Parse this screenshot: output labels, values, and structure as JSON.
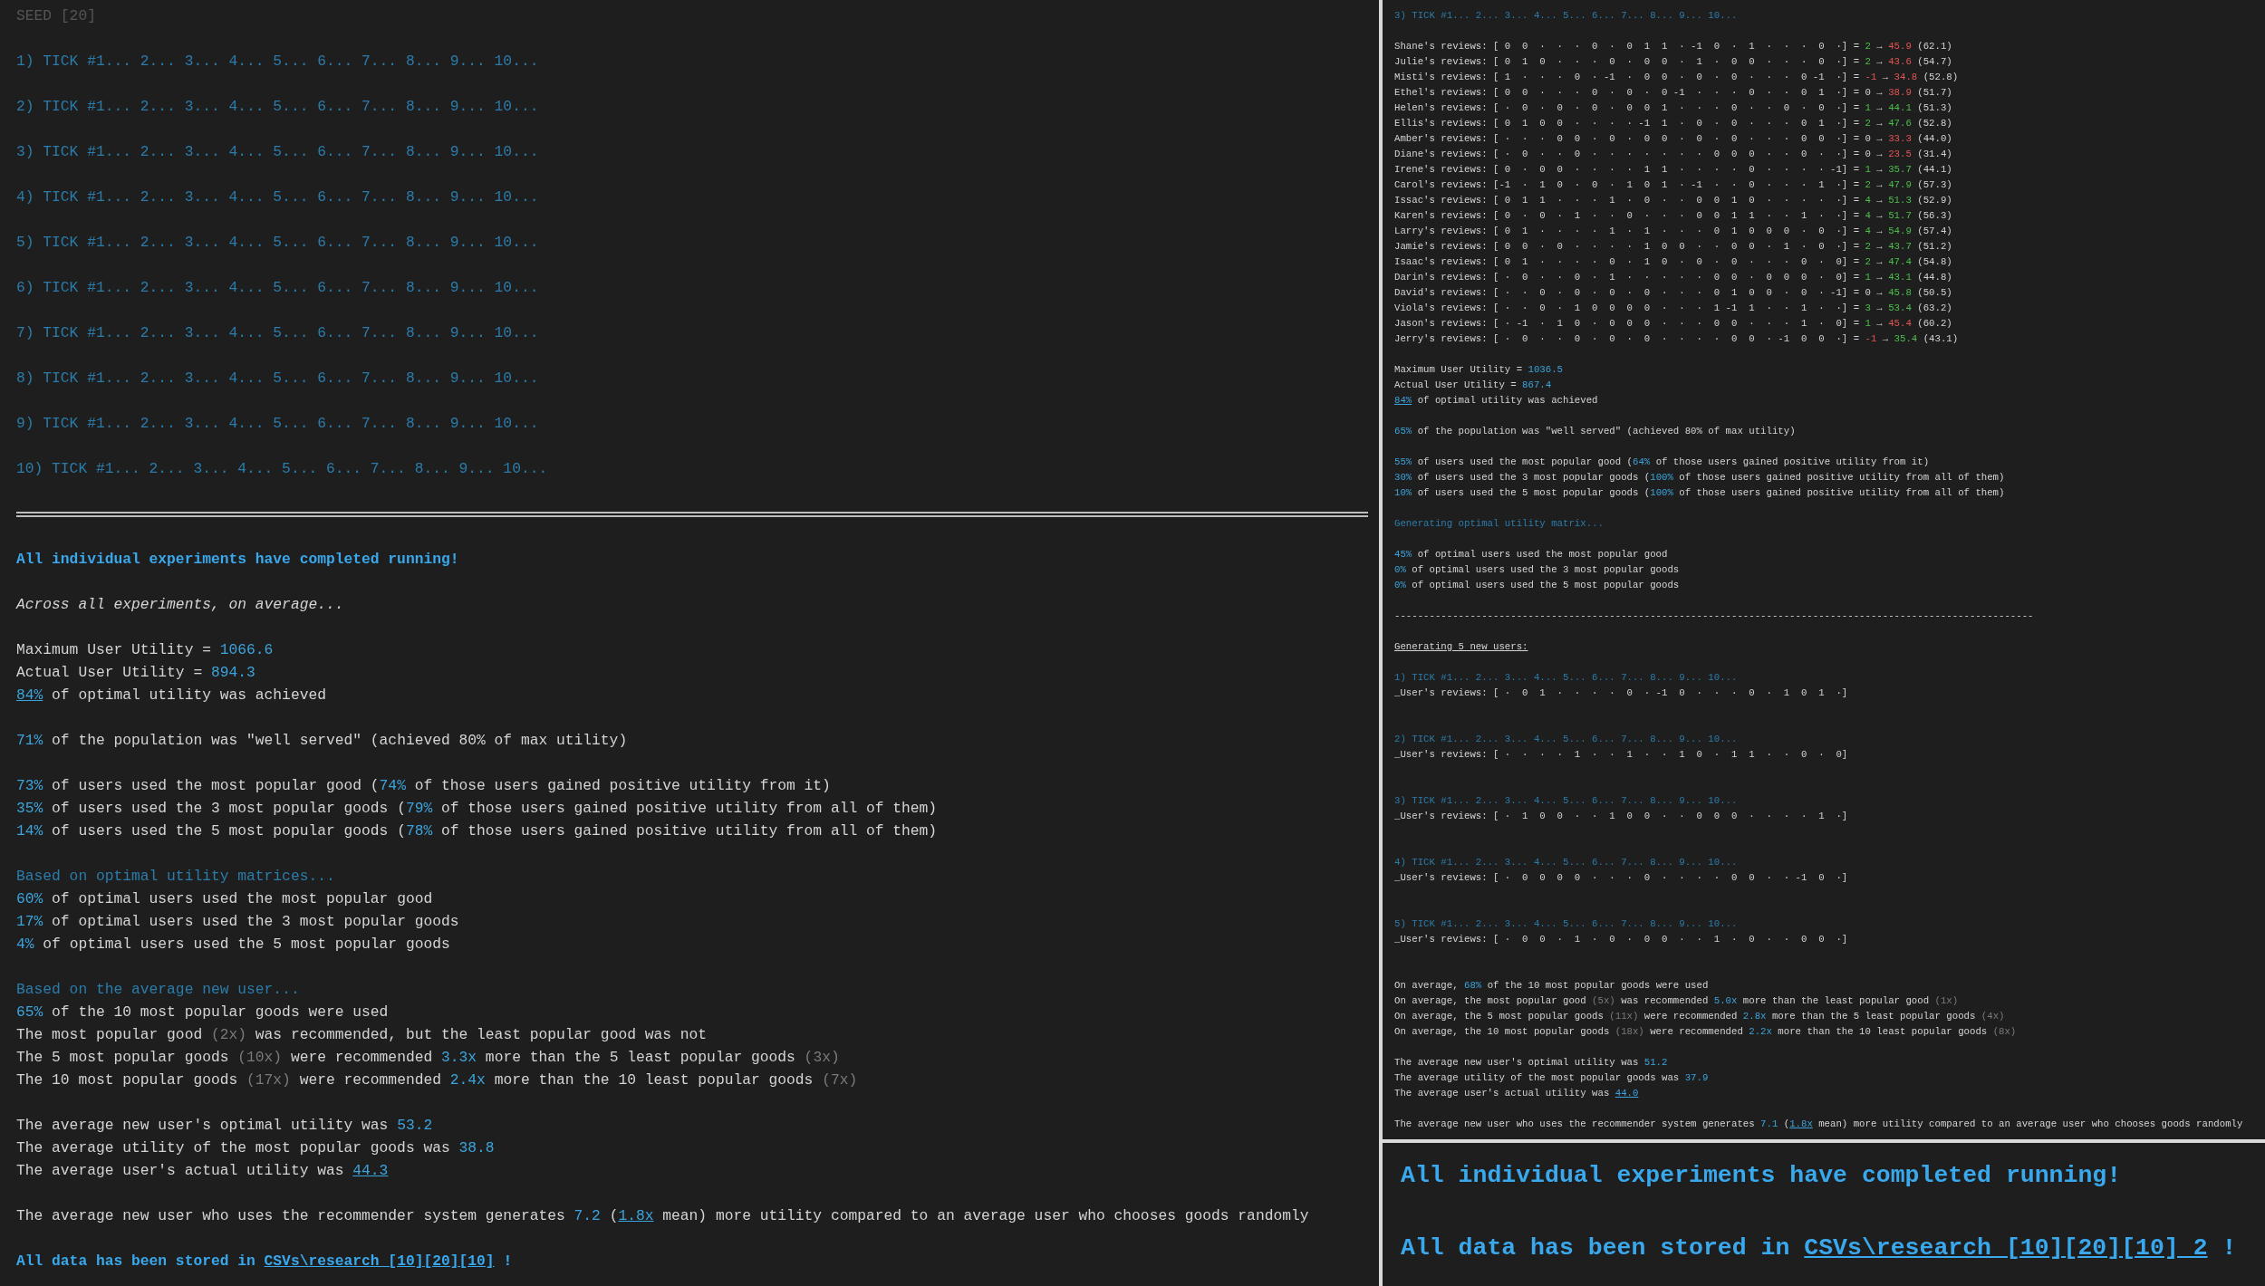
{
  "left_panel": {
    "lines": [
      {
        "kind": "text",
        "segments": [
          {
            "text": "SEED [20]",
            "kind": "seed"
          }
        ]
      },
      {
        "kind": "blank"
      },
      {
        "kind": "text",
        "segments": [
          {
            "text": "1) TICK #1... 2... 3... 4... 5... 6... 7... 8... 9... 10...",
            "kind": "dim"
          }
        ]
      },
      {
        "kind": "blank"
      },
      {
        "kind": "text",
        "segments": [
          {
            "text": "2) TICK #1... 2... 3... 4... 5... 6... 7... 8... 9... 10...",
            "kind": "dim"
          }
        ]
      },
      {
        "kind": "blank"
      },
      {
        "kind": "text",
        "segments": [
          {
            "text": "3) TICK #1... 2... 3... 4... 5... 6... 7... 8... 9... 10...",
            "kind": "dim"
          }
        ]
      },
      {
        "kind": "blank"
      },
      {
        "kind": "text",
        "segments": [
          {
            "text": "4) TICK #1... 2... 3... 4... 5... 6... 7... 8... 9... 10...",
            "kind": "dim"
          }
        ]
      },
      {
        "kind": "blank"
      },
      {
        "kind": "text",
        "segments": [
          {
            "text": "5) TICK #1... 2... 3... 4... 5... 6... 7... 8... 9... 10...",
            "kind": "dim"
          }
        ]
      },
      {
        "kind": "blank"
      },
      {
        "kind": "text",
        "segments": [
          {
            "text": "6) TICK #1... 2... 3... 4... 5... 6... 7... 8... 9... 10...",
            "kind": "dim"
          }
        ]
      },
      {
        "kind": "blank"
      },
      {
        "kind": "text",
        "segments": [
          {
            "text": "7) TICK #1... 2... 3... 4... 5... 6... 7... 8... 9... 10...",
            "kind": "dim"
          }
        ]
      },
      {
        "kind": "blank"
      },
      {
        "kind": "text",
        "segments": [
          {
            "text": "8) TICK #1... 2... 3... 4... 5... 6... 7... 8... 9... 10...",
            "kind": "dim"
          }
        ]
      },
      {
        "kind": "blank"
      },
      {
        "kind": "text",
        "segments": [
          {
            "text": "9) TICK #1... 2... 3... 4... 5... 6... 7... 8... 9... 10...",
            "kind": "dim"
          }
        ]
      },
      {
        "kind": "blank"
      },
      {
        "kind": "text",
        "segments": [
          {
            "text": "10) TICK #1... 2... 3... 4... 5... 6... 7... 8... 9... 10...",
            "kind": "dim"
          }
        ]
      },
      {
        "kind": "blank"
      },
      {
        "kind": "double_rule"
      },
      {
        "kind": "blank"
      },
      {
        "kind": "text",
        "segments": [
          {
            "text": "All individual experiments have completed running!",
            "kind": "title"
          }
        ]
      },
      {
        "kind": "blank"
      },
      {
        "kind": "text",
        "segments": [
          {
            "text": "Across all experiments, on average...",
            "kind": "italic"
          }
        ]
      },
      {
        "kind": "blank"
      },
      {
        "kind": "text",
        "segments": [
          {
            "text": "Maximum User Utility = ",
            "kind": "plain"
          },
          {
            "text": "1066.6",
            "kind": "value"
          }
        ]
      },
      {
        "kind": "text",
        "segments": [
          {
            "text": "Actual User Utility = ",
            "kind": "plain"
          },
          {
            "text": "894.3",
            "kind": "value"
          }
        ]
      },
      {
        "kind": "text",
        "segments": [
          {
            "text": "84%",
            "kind": "link"
          },
          {
            "text": " of optimal utility was achieved",
            "kind": "plain"
          }
        ]
      },
      {
        "kind": "blank"
      },
      {
        "kind": "text",
        "segments": [
          {
            "text": "71%",
            "kind": "value"
          },
          {
            "text": " of the population was \"well served\" (achieved 80% of max utility)",
            "kind": "plain"
          }
        ]
      },
      {
        "kind": "blank"
      },
      {
        "kind": "text",
        "segments": [
          {
            "text": "73%",
            "kind": "value"
          },
          {
            "text": " of users used the most popular good (",
            "kind": "plain"
          },
          {
            "text": "74%",
            "kind": "value"
          },
          {
            "text": " of those users gained positive utility from it)",
            "kind": "plain"
          }
        ]
      },
      {
        "kind": "text",
        "segments": [
          {
            "text": "35%",
            "kind": "value"
          },
          {
            "text": " of users used the 3 most popular goods (",
            "kind": "plain"
          },
          {
            "text": "79%",
            "kind": "value"
          },
          {
            "text": " of those users gained positive utility from all of them)",
            "kind": "plain"
          }
        ]
      },
      {
        "kind": "text",
        "segments": [
          {
            "text": "14%",
            "kind": "value"
          },
          {
            "text": " of users used the 5 most popular goods (",
            "kind": "plain"
          },
          {
            "text": "78%",
            "kind": "value"
          },
          {
            "text": " of those users gained positive utility from all of them)",
            "kind": "plain"
          }
        ]
      },
      {
        "kind": "blank"
      },
      {
        "kind": "text",
        "segments": [
          {
            "text": "Based on optimal utility matrices...",
            "kind": "dim"
          }
        ]
      },
      {
        "kind": "text",
        "segments": [
          {
            "text": "60%",
            "kind": "value"
          },
          {
            "text": " of optimal users used the most popular good",
            "kind": "plain"
          }
        ]
      },
      {
        "kind": "text",
        "segments": [
          {
            "text": "17%",
            "kind": "value"
          },
          {
            "text": " of optimal users used the 3 most popular goods",
            "kind": "plain"
          }
        ]
      },
      {
        "kind": "text",
        "segments": [
          {
            "text": "4%",
            "kind": "value"
          },
          {
            "text": " of optimal users used the 5 most popular goods",
            "kind": "plain"
          }
        ]
      },
      {
        "kind": "blank"
      },
      {
        "kind": "text",
        "segments": [
          {
            "text": "Based on the average new user...",
            "kind": "dim"
          }
        ]
      },
      {
        "kind": "text",
        "segments": [
          {
            "text": "65%",
            "kind": "value"
          },
          {
            "text": " of the 10 most popular goods were used",
            "kind": "plain"
          }
        ]
      },
      {
        "kind": "text",
        "segments": [
          {
            "text": "The most popular good ",
            "kind": "plain"
          },
          {
            "text": "(2x)",
            "kind": "muted"
          },
          {
            "text": " was recommended, but the least popular good was not",
            "kind": "plain"
          }
        ]
      },
      {
        "kind": "text",
        "segments": [
          {
            "text": "The 5 most popular goods ",
            "kind": "plain"
          },
          {
            "text": "(10x)",
            "kind": "muted"
          },
          {
            "text": " were recommended ",
            "kind": "plain"
          },
          {
            "text": "3.3x",
            "kind": "value"
          },
          {
            "text": " more than the 5 least popular goods ",
            "kind": "plain"
          },
          {
            "text": "(3x)",
            "kind": "muted"
          }
        ]
      },
      {
        "kind": "text",
        "segments": [
          {
            "text": "The 10 most popular goods ",
            "kind": "plain"
          },
          {
            "text": "(17x)",
            "kind": "muted"
          },
          {
            "text": " were recommended ",
            "kind": "plain"
          },
          {
            "text": "2.4x",
            "kind": "value"
          },
          {
            "text": " more than the 10 least popular goods ",
            "kind": "plain"
          },
          {
            "text": "(7x)",
            "kind": "muted"
          }
        ]
      },
      {
        "kind": "blank"
      },
      {
        "kind": "text",
        "segments": [
          {
            "text": "The average new user's optimal utility was ",
            "kind": "plain"
          },
          {
            "text": "53.2",
            "kind": "value"
          }
        ]
      },
      {
        "kind": "text",
        "segments": [
          {
            "text": "The average utility of the most popular goods was ",
            "kind": "plain"
          },
          {
            "text": "38.8",
            "kind": "value"
          }
        ]
      },
      {
        "kind": "text",
        "segments": [
          {
            "text": "The average user's actual utility was ",
            "kind": "plain"
          },
          {
            "text": "44.3",
            "kind": "link"
          }
        ]
      },
      {
        "kind": "blank"
      },
      {
        "kind": "text",
        "segments": [
          {
            "text": "The average new user who uses the recommender system generates ",
            "kind": "plain"
          },
          {
            "text": "7.2",
            "kind": "value"
          },
          {
            "text": " (",
            "kind": "plain"
          },
          {
            "text": "1.8x",
            "kind": "link"
          },
          {
            "text": " mean) more utility compared to an average user who chooses goods randomly",
            "kind": "plain"
          }
        ]
      },
      {
        "kind": "blank"
      },
      {
        "kind": "text",
        "segments": [
          {
            "text": "All data has been stored in ",
            "kind": "title"
          },
          {
            "text": "CSVs\\research_[10][20][10]",
            "kind": "title_link"
          },
          {
            "text": " !",
            "kind": "title"
          }
        ]
      }
    ]
  },
  "right_panel": {
    "lines": [
      {
        "kind": "text",
        "segments": [
          {
            "text": "3) TICK #1... 2... 3... 4... 5... 6... 7... 8... 9... 10...",
            "kind": "dim"
          }
        ]
      },
      {
        "kind": "blank"
      },
      {
        "kind": "text",
        "segments": [
          {
            "text": "Shane's reviews: [ 0  0  ·  ·  ·  0  ·  0  1  1  · -1  0  ·  1  ·  ·  ·  0  ·] = ",
            "kind": "plain"
          },
          {
            "text": "2",
            "kind": "green"
          },
          {
            "text": " → ",
            "kind": "plain"
          },
          {
            "text": "45.9",
            "kind": "red"
          },
          {
            "text": " (62.1)",
            "kind": "plain"
          }
        ]
      },
      {
        "kind": "text",
        "segments": [
          {
            "text": "Julie's reviews: [ 0  1  0  ·  ·  ·  0  ·  0  0  ·  1  ·  0  0  ·  ·  ·  0  ·] = ",
            "kind": "plain"
          },
          {
            "text": "2",
            "kind": "green"
          },
          {
            "text": " → ",
            "kind": "plain"
          },
          {
            "text": "43.6",
            "kind": "red"
          },
          {
            "text": " (54.7)",
            "kind": "plain"
          }
        ]
      },
      {
        "kind": "text",
        "segments": [
          {
            "text": "Misti's reviews: [ 1  ·  ·  ·  0  · -1  ·  0  0  ·  0  ·  0  ·  ·  ·  0 -1  ·] = ",
            "kind": "plain"
          },
          {
            "text": "-1",
            "kind": "red"
          },
          {
            "text": " → ",
            "kind": "plain"
          },
          {
            "text": "34.8",
            "kind": "red"
          },
          {
            "text": " (52.8)",
            "kind": "plain"
          }
        ]
      },
      {
        "kind": "text",
        "segments": [
          {
            "text": "Ethel's reviews: [ 0  0  ·  ·  ·  0  ·  0  ·  0 -1  ·  ·  ·  0  ·  ·  0  1  ·] = ",
            "kind": "plain"
          },
          {
            "text": "0",
            "kind": "plain"
          },
          {
            "text": " → ",
            "kind": "plain"
          },
          {
            "text": "38.9",
            "kind": "red"
          },
          {
            "text": " (51.7)",
            "kind": "plain"
          }
        ]
      },
      {
        "kind": "text",
        "segments": [
          {
            "text": "Helen's reviews: [ ·  0  ·  0  ·  0  ·  0  0  1  ·  ·  ·  0  ·  ·  0  ·  0  ·] = ",
            "kind": "plain"
          },
          {
            "text": "1",
            "kind": "green"
          },
          {
            "text": " → ",
            "kind": "plain"
          },
          {
            "text": "44.1",
            "kind": "green"
          },
          {
            "text": " (51.3)",
            "kind": "plain"
          }
        ]
      },
      {
        "kind": "text",
        "segments": [
          {
            "text": "Ellis's reviews: [ 0  1  0  0  ·  ·  ·  · -1  1  ·  0  ·  0  ·  ·  ·  0  1  ·] = ",
            "kind": "plain"
          },
          {
            "text": "2",
            "kind": "green"
          },
          {
            "text": " → ",
            "kind": "plain"
          },
          {
            "text": "47.6",
            "kind": "green"
          },
          {
            "text": " (52.8)",
            "kind": "plain"
          }
        ]
      },
      {
        "kind": "text",
        "segments": [
          {
            "text": "Amber's reviews: [ ·  ·  ·  0  0  ·  0  ·  0  0  ·  0  ·  0  ·  ·  ·  0  0  ·] = ",
            "kind": "plain"
          },
          {
            "text": "0",
            "kind": "plain"
          },
          {
            "text": " → ",
            "kind": "plain"
          },
          {
            "text": "33.3",
            "kind": "red"
          },
          {
            "text": " (44.0)",
            "kind": "plain"
          }
        ]
      },
      {
        "kind": "text",
        "segments": [
          {
            "text": "Diane's reviews: [ ·  0  ·  ·  0  ·  ·  ·  ·  ·  ·  ·  0  0  0  ·  ·  0  ·  ·] = ",
            "kind": "plain"
          },
          {
            "text": "0",
            "kind": "plain"
          },
          {
            "text": " → ",
            "kind": "plain"
          },
          {
            "text": "23.5",
            "kind": "red"
          },
          {
            "text": " (31.4)",
            "kind": "plain"
          }
        ]
      },
      {
        "kind": "text",
        "segments": [
          {
            "text": "Irene's reviews: [ 0  ·  0  0  ·  ·  ·  ·  1  1  ·  ·  ·  ·  0  ·  ·  ·  · -1] = ",
            "kind": "plain"
          },
          {
            "text": "1",
            "kind": "green"
          },
          {
            "text": " → ",
            "kind": "plain"
          },
          {
            "text": "35.7",
            "kind": "green"
          },
          {
            "text": " (44.1)",
            "kind": "plain"
          }
        ]
      },
      {
        "kind": "text",
        "segments": [
          {
            "text": "Carol's reviews: [-1  ·  1  0  ·  0  ·  1  0  1  · -1  ·  ·  0  ·  ·  ·  1  ·] = ",
            "kind": "plain"
          },
          {
            "text": "2",
            "kind": "green"
          },
          {
            "text": " → ",
            "kind": "plain"
          },
          {
            "text": "47.9",
            "kind": "green"
          },
          {
            "text": " (57.3)",
            "kind": "plain"
          }
        ]
      },
      {
        "kind": "text",
        "segments": [
          {
            "text": "Issac's reviews: [ 0  1  1  ·  ·  ·  1  ·  0  ·  ·  0  0  1  0  ·  ·  ·  ·  ·] = ",
            "kind": "plain"
          },
          {
            "text": "4",
            "kind": "green"
          },
          {
            "text": " → ",
            "kind": "plain"
          },
          {
            "text": "51.3",
            "kind": "green"
          },
          {
            "text": " (52.9)",
            "kind": "plain"
          }
        ]
      },
      {
        "kind": "text",
        "segments": [
          {
            "text": "Karen's reviews: [ 0  ·  0  ·  1  ·  ·  0  ·  ·  ·  0  0  1  1  ·  ·  1  ·  ·] = ",
            "kind": "plain"
          },
          {
            "text": "4",
            "kind": "green"
          },
          {
            "text": " → ",
            "kind": "plain"
          },
          {
            "text": "51.7",
            "kind": "green"
          },
          {
            "text": " (56.3)",
            "kind": "plain"
          }
        ]
      },
      {
        "kind": "text",
        "segments": [
          {
            "text": "Larry's reviews: [ 0  1  ·  ·  ·  ·  1  ·  1  ·  ·  ·  0  1  0  0  0  ·  0  ·] = ",
            "kind": "plain"
          },
          {
            "text": "4",
            "kind": "green"
          },
          {
            "text": " → ",
            "kind": "plain"
          },
          {
            "text": "54.9",
            "kind": "green"
          },
          {
            "text": " (57.4)",
            "kind": "plain"
          }
        ]
      },
      {
        "kind": "text",
        "segments": [
          {
            "text": "Jamie's reviews: [ 0  0  ·  0  ·  ·  ·  ·  1  0  0  ·  ·  0  0  ·  1  ·  0  ·] = ",
            "kind": "plain"
          },
          {
            "text": "2",
            "kind": "green"
          },
          {
            "text": " → ",
            "kind": "plain"
          },
          {
            "text": "43.7",
            "kind": "green"
          },
          {
            "text": " (51.2)",
            "kind": "plain"
          }
        ]
      },
      {
        "kind": "text",
        "segments": [
          {
            "text": "Isaac's reviews: [ 0  1  ·  ·  ·  ·  0  ·  1  0  ·  0  ·  0  ·  ·  ·  0  ·  0] = ",
            "kind": "plain"
          },
          {
            "text": "2",
            "kind": "green"
          },
          {
            "text": " → ",
            "kind": "plain"
          },
          {
            "text": "47.4",
            "kind": "green"
          },
          {
            "text": " (54.8)",
            "kind": "plain"
          }
        ]
      },
      {
        "kind": "text",
        "segments": [
          {
            "text": "Darin's reviews: [ ·  0  ·  ·  0  ·  1  ·  ·  ·  ·  ·  0  0  ·  0  0  0  ·  0] = ",
            "kind": "plain"
          },
          {
            "text": "1",
            "kind": "green"
          },
          {
            "text": " → ",
            "kind": "plain"
          },
          {
            "text": "43.1",
            "kind": "green"
          },
          {
            "text": " (44.8)",
            "kind": "plain"
          }
        ]
      },
      {
        "kind": "text",
        "segments": [
          {
            "text": "David's reviews: [ ·  ·  0  ·  0  ·  0  ·  0  ·  ·  ·  0  1  0  0  ·  0  · -1] = ",
            "kind": "plain"
          },
          {
            "text": "0",
            "kind": "plain"
          },
          {
            "text": " → ",
            "kind": "plain"
          },
          {
            "text": "45.8",
            "kind": "green"
          },
          {
            "text": " (50.5)",
            "kind": "plain"
          }
        ]
      },
      {
        "kind": "text",
        "segments": [
          {
            "text": "Viola's reviews: [ ·  ·  0  ·  1  0  0  0  0  ·  ·  ·  1 -1  1  ·  ·  1  ·  ·] = ",
            "kind": "plain"
          },
          {
            "text": "3",
            "kind": "green"
          },
          {
            "text": " → ",
            "kind": "plain"
          },
          {
            "text": "53.4",
            "kind": "green"
          },
          {
            "text": " (63.2)",
            "kind": "plain"
          }
        ]
      },
      {
        "kind": "text",
        "segments": [
          {
            "text": "Jason's reviews: [ · -1  ·  1  0  ·  0  0  0  ·  ·  ·  0  0  ·  ·  ·  1  ·  0] = ",
            "kind": "plain"
          },
          {
            "text": "1",
            "kind": "green"
          },
          {
            "text": " → ",
            "kind": "plain"
          },
          {
            "text": "45.4",
            "kind": "red"
          },
          {
            "text": " (60.2)",
            "kind": "plain"
          }
        ]
      },
      {
        "kind": "text",
        "segments": [
          {
            "text": "Jerry's reviews: [ ·  0  ·  ·  0  ·  0  ·  0  ·  ·  ·  ·  0  0  · -1  0  0  ·] = ",
            "kind": "plain"
          },
          {
            "text": "-1",
            "kind": "red"
          },
          {
            "text": " → ",
            "kind": "plain"
          },
          {
            "text": "35.4",
            "kind": "green"
          },
          {
            "text": " (43.1)",
            "kind": "plain"
          }
        ]
      },
      {
        "kind": "blank"
      },
      {
        "kind": "text",
        "segments": [
          {
            "text": "Maximum User Utility = ",
            "kind": "plain"
          },
          {
            "text": "1036.5",
            "kind": "value"
          }
        ]
      },
      {
        "kind": "text",
        "segments": [
          {
            "text": "Actual User Utility = ",
            "kind": "plain"
          },
          {
            "text": "867.4",
            "kind": "value"
          }
        ]
      },
      {
        "kind": "text",
        "segments": [
          {
            "text": "84%",
            "kind": "link"
          },
          {
            "text": " of optimal utility was achieved",
            "kind": "plain"
          }
        ]
      },
      {
        "kind": "blank"
      },
      {
        "kind": "text",
        "segments": [
          {
            "text": "65%",
            "kind": "value"
          },
          {
            "text": " of the population was \"well served\" (achieved 80% of max utility)",
            "kind": "plain"
          }
        ]
      },
      {
        "kind": "blank"
      },
      {
        "kind": "text",
        "segments": [
          {
            "text": "55%",
            "kind": "value"
          },
          {
            "text": " of users used the most popular good (",
            "kind": "plain"
          },
          {
            "text": "64%",
            "kind": "value"
          },
          {
            "text": " of those users gained positive utility from it)",
            "kind": "plain"
          }
        ]
      },
      {
        "kind": "text",
        "segments": [
          {
            "text": "30%",
            "kind": "value"
          },
          {
            "text": " of users used the 3 most popular goods (",
            "kind": "plain"
          },
          {
            "text": "100%",
            "kind": "value"
          },
          {
            "text": " of those users gained positive utility from all of them)",
            "kind": "plain"
          }
        ]
      },
      {
        "kind": "text",
        "segments": [
          {
            "text": "10%",
            "kind": "value"
          },
          {
            "text": " of users used the 5 most popular goods (",
            "kind": "plain"
          },
          {
            "text": "100%",
            "kind": "value"
          },
          {
            "text": " of those users gained positive utility from all of them)",
            "kind": "plain"
          }
        ]
      },
      {
        "kind": "blank"
      },
      {
        "kind": "text",
        "segments": [
          {
            "text": "Generating optimal utility matrix...",
            "kind": "dim"
          }
        ]
      },
      {
        "kind": "blank"
      },
      {
        "kind": "text",
        "segments": [
          {
            "text": "45%",
            "kind": "value"
          },
          {
            "text": " of optimal users used the most popular good",
            "kind": "plain"
          }
        ]
      },
      {
        "kind": "text",
        "segments": [
          {
            "text": "0%",
            "kind": "value"
          },
          {
            "text": " of optimal users used the 3 most popular goods",
            "kind": "plain"
          }
        ]
      },
      {
        "kind": "text",
        "segments": [
          {
            "text": "0%",
            "kind": "value"
          },
          {
            "text": " of optimal users used the 5 most popular goods",
            "kind": "plain"
          }
        ]
      },
      {
        "kind": "blank"
      },
      {
        "kind": "text",
        "segments": [
          {
            "text": "--------------------------------------------------------------------------------------------------------------",
            "kind": "plain"
          }
        ]
      },
      {
        "kind": "blank"
      },
      {
        "kind": "text",
        "segments": [
          {
            "text": "Generating 5 new users:",
            "kind": "underline"
          }
        ]
      },
      {
        "kind": "blank"
      },
      {
        "kind": "text",
        "segments": [
          {
            "text": "1) TICK #1... 2... 3... 4... 5... 6... 7... 8... 9... 10...",
            "kind": "dim"
          }
        ]
      },
      {
        "kind": "text",
        "segments": [
          {
            "text": "_User's reviews: [ ·  0  1  ·  ·  ·  ·  0  · -1  0  ·  ·  ·  0  ·  1  0  1  ·]",
            "kind": "plain"
          }
        ]
      },
      {
        "kind": "blank"
      },
      {
        "kind": "blank"
      },
      {
        "kind": "text",
        "segments": [
          {
            "text": "2) TICK #1... 2... 3... 4... 5... 6... 7... 8... 9... 10...",
            "kind": "dim"
          }
        ]
      },
      {
        "kind": "text",
        "segments": [
          {
            "text": "_User's reviews: [ ·  ·  ·  ·  1  ·  ·  1  ·  ·  1  0  ·  1  1  ·  ·  0  ·  0]",
            "kind": "plain"
          }
        ]
      },
      {
        "kind": "blank"
      },
      {
        "kind": "blank"
      },
      {
        "kind": "text",
        "segments": [
          {
            "text": "3) TICK #1... 2... 3... 4... 5... 6... 7... 8... 9... 10...",
            "kind": "dim"
          }
        ]
      },
      {
        "kind": "text",
        "segments": [
          {
            "text": "_User's reviews: [ ·  1  0  0  ·  ·  1  0  0  ·  ·  0  0  0  ·  ·  ·  ·  1  ·]",
            "kind": "plain"
          }
        ]
      },
      {
        "kind": "blank"
      },
      {
        "kind": "blank"
      },
      {
        "kind": "text",
        "segments": [
          {
            "text": "4) TICK #1... 2... 3... 4... 5... 6... 7... 8... 9... 10...",
            "kind": "dim"
          }
        ]
      },
      {
        "kind": "text",
        "segments": [
          {
            "text": "_User's reviews: [ ·  0  0  0  0  ·  ·  ·  0  ·  ·  ·  ·  0  0  ·  · -1  0  ·]",
            "kind": "plain"
          }
        ]
      },
      {
        "kind": "blank"
      },
      {
        "kind": "blank"
      },
      {
        "kind": "text",
        "segments": [
          {
            "text": "5) TICK #1... 2... 3... 4... 5... 6... 7... 8... 9... 10...",
            "kind": "dim"
          }
        ]
      },
      {
        "kind": "text",
        "segments": [
          {
            "text": "_User's reviews: [ ·  0  0  ·  1  ·  0  ·  0  0  ·  ·  1  ·  0  ·  ·  0  0  ·]",
            "kind": "plain"
          }
        ]
      },
      {
        "kind": "blank"
      },
      {
        "kind": "blank"
      },
      {
        "kind": "text",
        "segments": [
          {
            "text": "On average, ",
            "kind": "plain"
          },
          {
            "text": "68%",
            "kind": "value"
          },
          {
            "text": " of the 10 most popular goods were used",
            "kind": "plain"
          }
        ]
      },
      {
        "kind": "text",
        "segments": [
          {
            "text": "On average, the most popular good ",
            "kind": "plain"
          },
          {
            "text": "(5x)",
            "kind": "muted"
          },
          {
            "text": " was recommended ",
            "kind": "plain"
          },
          {
            "text": "5.0x",
            "kind": "value"
          },
          {
            "text": " more than the least popular good ",
            "kind": "plain"
          },
          {
            "text": "(1x)",
            "kind": "muted"
          }
        ]
      },
      {
        "kind": "text",
        "segments": [
          {
            "text": "On average, the 5 most popular goods ",
            "kind": "plain"
          },
          {
            "text": "(11x)",
            "kind": "muted"
          },
          {
            "text": " were recommended ",
            "kind": "plain"
          },
          {
            "text": "2.8x",
            "kind": "value"
          },
          {
            "text": " more than the 5 least popular goods ",
            "kind": "plain"
          },
          {
            "text": "(4x)",
            "kind": "muted"
          }
        ]
      },
      {
        "kind": "text",
        "segments": [
          {
            "text": "On average, the 10 most popular goods ",
            "kind": "plain"
          },
          {
            "text": "(18x)",
            "kind": "muted"
          },
          {
            "text": " were recommended ",
            "kind": "plain"
          },
          {
            "text": "2.2x",
            "kind": "value"
          },
          {
            "text": " more than the 10 least popular goods ",
            "kind": "plain"
          },
          {
            "text": "(8x)",
            "kind": "muted"
          }
        ]
      },
      {
        "kind": "blank"
      },
      {
        "kind": "text",
        "segments": [
          {
            "text": "The average new user's optimal utility was ",
            "kind": "plain"
          },
          {
            "text": "51.2",
            "kind": "value"
          }
        ]
      },
      {
        "kind": "text",
        "segments": [
          {
            "text": "The average utility of the most popular goods was ",
            "kind": "plain"
          },
          {
            "text": "37.9",
            "kind": "value"
          }
        ]
      },
      {
        "kind": "text",
        "segments": [
          {
            "text": "The average user's actual utility was ",
            "kind": "plain"
          },
          {
            "text": "44.0",
            "kind": "link"
          }
        ]
      },
      {
        "kind": "blank"
      },
      {
        "kind": "text",
        "segments": [
          {
            "text": "The average new user who uses the recommender system generates ",
            "kind": "plain"
          },
          {
            "text": "7.1",
            "kind": "value"
          },
          {
            "text": " (",
            "kind": "plain"
          },
          {
            "text": "1.8x",
            "kind": "link"
          },
          {
            "text": " mean) more utility compared to an average user who chooses goods randomly",
            "kind": "plain"
          }
        ]
      }
    ]
  },
  "bottom_panel": {
    "lines": [
      {
        "kind": "text",
        "segments": [
          {
            "text": "All individual experiments have completed running!",
            "kind": "title"
          }
        ]
      },
      {
        "kind": "blank"
      },
      {
        "kind": "text",
        "segments": [
          {
            "text": "All data has been stored in ",
            "kind": "title"
          },
          {
            "text": "CSVs\\research_[10][20][10]_2",
            "kind": "title_link"
          },
          {
            "text": " !",
            "kind": "title"
          }
        ]
      }
    ]
  }
}
